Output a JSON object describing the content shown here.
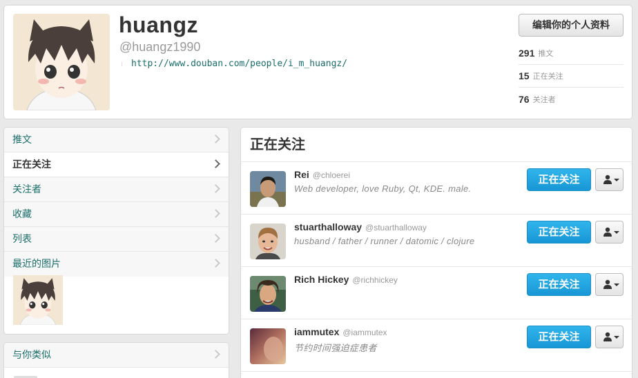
{
  "profile": {
    "name": "huangz",
    "handle": "@huangz1990",
    "url": "http://www.douban.com/people/i_m_huangz/",
    "edit_label": "编辑你的个人资料",
    "stats": [
      {
        "num": "291",
        "label": "推文"
      },
      {
        "num": "15",
        "label": "正在关注"
      },
      {
        "num": "76",
        "label": "关注者"
      }
    ]
  },
  "sidebar": {
    "items": [
      {
        "label": "推文"
      },
      {
        "label": "正在关注"
      },
      {
        "label": "关注者"
      },
      {
        "label": "收藏"
      },
      {
        "label": "列表"
      },
      {
        "label": "最近的图片"
      }
    ],
    "similar_label": "与你类似"
  },
  "main": {
    "title": "正在关注",
    "users": [
      {
        "name": "Rei",
        "handle": "@chloerei",
        "bio": "Web developer, love Ruby, Qt, KDE. male.",
        "follow_label": "正在关注"
      },
      {
        "name": "stuarthalloway",
        "handle": "@stuarthalloway",
        "bio": "husband / father / runner / datomic / clojure",
        "follow_label": "正在关注"
      },
      {
        "name": "Rich Hickey",
        "handle": "@richhickey",
        "bio": "",
        "follow_label": "正在关注"
      },
      {
        "name": "iammutex",
        "handle": "@iammutex",
        "bio": "节约时间强迫症患者",
        "follow_label": "正在关注"
      }
    ]
  },
  "colors": {
    "link": "#1a6e6a",
    "follow_button": "#1797d6",
    "background": "#e9e9e9"
  }
}
